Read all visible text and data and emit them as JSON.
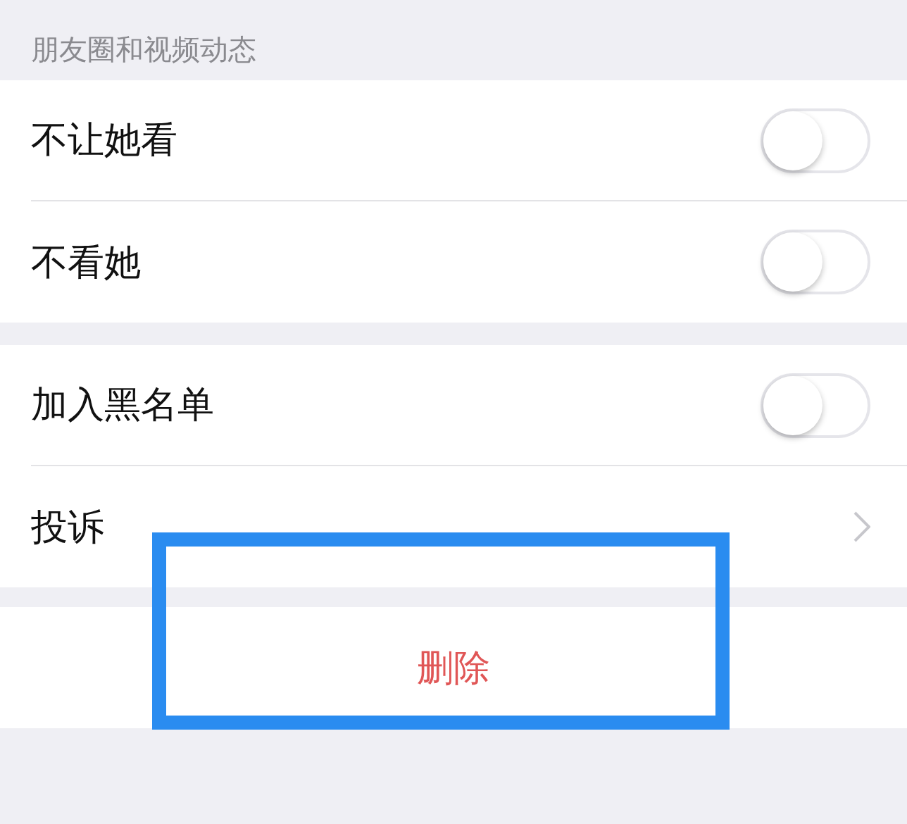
{
  "section_header": "朋友圈和视频动态",
  "groups": [
    {
      "rows": [
        {
          "kind": "switch",
          "label": "不让她看",
          "on": false
        },
        {
          "kind": "switch",
          "label": "不看她",
          "on": false
        }
      ]
    },
    {
      "rows": [
        {
          "kind": "switch",
          "label": "加入黑名单",
          "on": false
        },
        {
          "kind": "link",
          "label": "投诉"
        }
      ]
    }
  ],
  "delete_button": "删除"
}
